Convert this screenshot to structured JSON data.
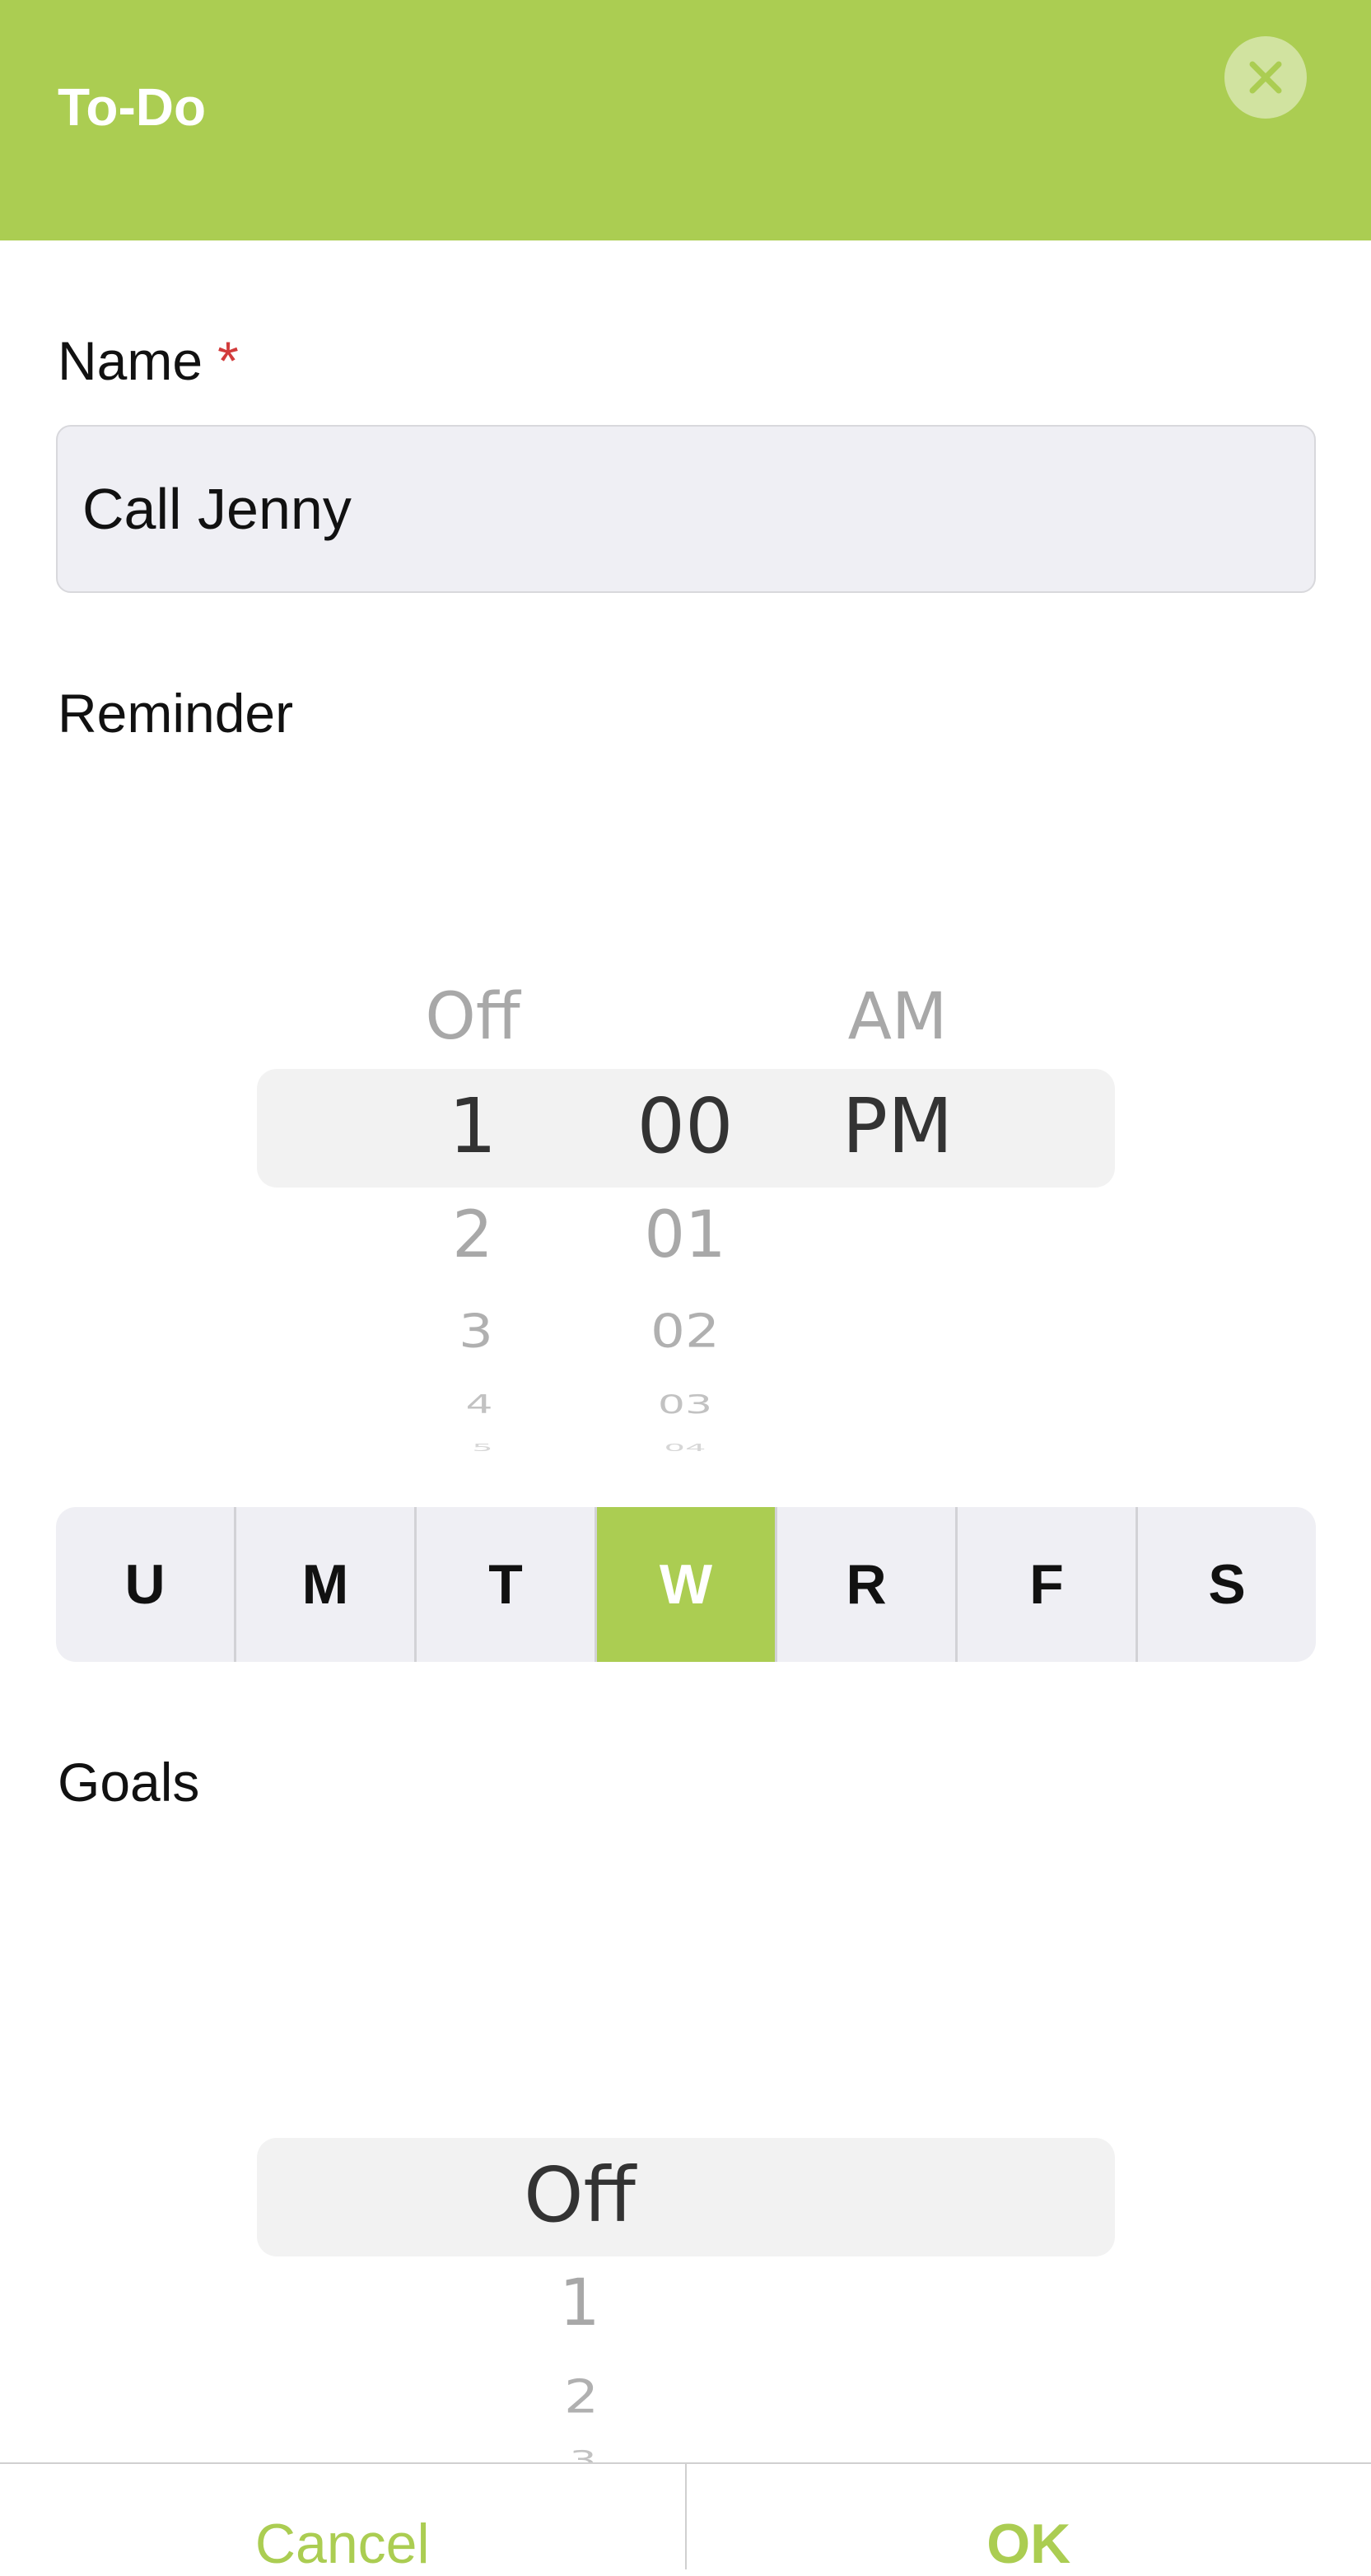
{
  "header": {
    "title": "To-Do",
    "close_icon": "close-icon"
  },
  "name": {
    "label": "Name",
    "required_mark": "*",
    "value": "Call Jenny"
  },
  "reminder": {
    "label": "Reminder",
    "hour": {
      "above": "Off",
      "selected": "1",
      "below": [
        "2",
        "3",
        "4",
        "5"
      ]
    },
    "minute": {
      "selected": "00",
      "below": [
        "01",
        "02",
        "03",
        "04"
      ]
    },
    "ampm": {
      "above": "AM",
      "selected": "PM"
    }
  },
  "days": {
    "items": [
      "U",
      "M",
      "T",
      "W",
      "R",
      "F",
      "S"
    ],
    "selected": "W"
  },
  "goals": {
    "label": "Goals",
    "selected": "Off",
    "below": [
      "1",
      "2",
      "3"
    ]
  },
  "footer": {
    "cancel_label": "Cancel",
    "ok_label": "OK"
  },
  "colors": {
    "accent": "#abcd52",
    "required": "#d23b3b"
  }
}
